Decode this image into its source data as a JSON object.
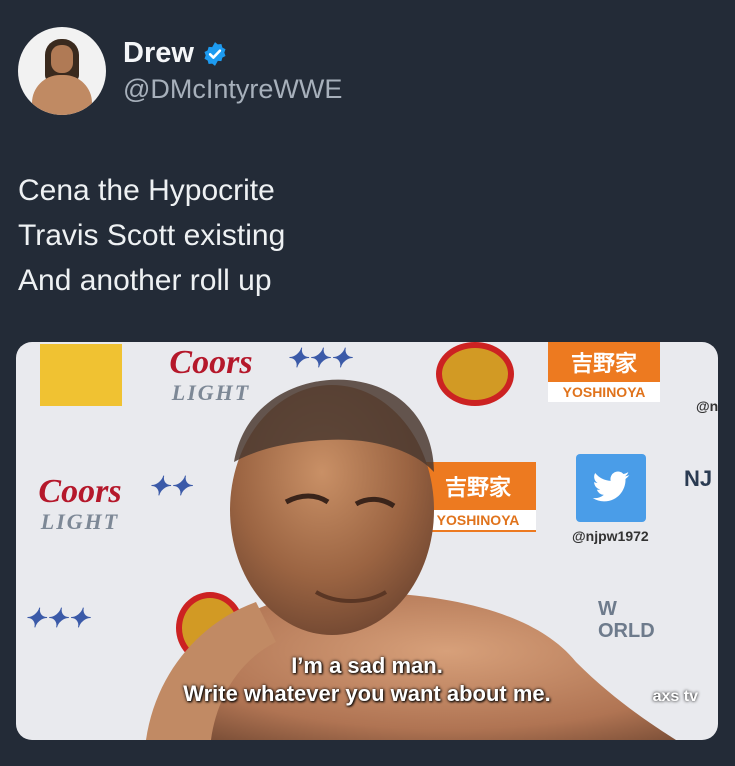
{
  "tweet": {
    "display_name": "Drew",
    "handle": "@DMcIntyreWWE",
    "verified": true,
    "lines": [
      "Cena the Hypocrite",
      "Travis Scott existing",
      "And another roll up"
    ]
  },
  "media": {
    "subtitle_line1": "I’m a sad man.",
    "subtitle_line2": "Write whatever you want about me.",
    "broadcaster": "axs tv",
    "backdrop": {
      "coors_brand": "Coors",
      "coors_sub": "LIGHT",
      "yoshinoya": "YOSHINOYA",
      "njpw_handle": "@njpw1972",
      "nj_partial": "NJ",
      "njpw_partial_handle": "@n",
      "world_partial": "W\nORLD"
    }
  },
  "colors": {
    "background": "#232b37",
    "verified_blue": "#1d9bf0",
    "handle_gray": "#a7b0bb"
  }
}
